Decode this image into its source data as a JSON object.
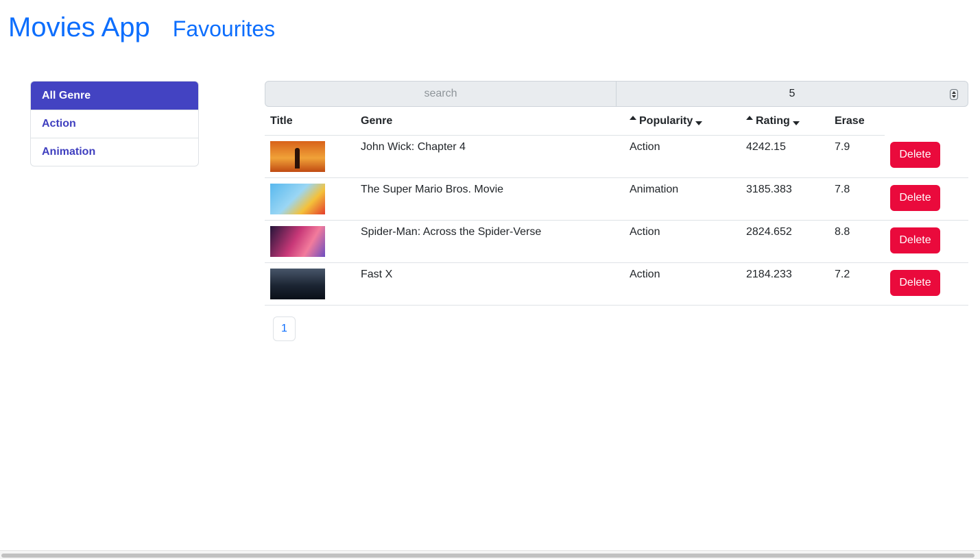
{
  "nav": {
    "brand": "Movies App",
    "favourites": "Favourites"
  },
  "genres": [
    {
      "label": "All Genre",
      "active": true
    },
    {
      "label": "Action",
      "active": false
    },
    {
      "label": "Animation",
      "active": false
    }
  ],
  "search": {
    "placeholder": "search",
    "value": ""
  },
  "count": {
    "value": "5"
  },
  "table": {
    "headers": {
      "title": "Title",
      "genre": "Genre",
      "popularity": "Popularity",
      "rating": "Rating",
      "erase": "Erase"
    },
    "rows": [
      {
        "title": "John Wick: Chapter 4",
        "genre": "Action",
        "popularity": "4242.15",
        "rating": "7.9",
        "action": "Delete"
      },
      {
        "title": "The Super Mario Bros. Movie",
        "genre": "Animation",
        "popularity": "3185.383",
        "rating": "7.8",
        "action": "Delete"
      },
      {
        "title": "Spider-Man: Across the Spider-Verse",
        "genre": "Action",
        "popularity": "2824.652",
        "rating": "8.8",
        "action": "Delete"
      },
      {
        "title": "Fast X",
        "genre": "Action",
        "popularity": "2184.233",
        "rating": "7.2",
        "action": "Delete"
      }
    ]
  },
  "pagination": {
    "pages": [
      "1"
    ]
  },
  "colors": {
    "brand": "#0d6efd",
    "active_genre": "#4343c2",
    "delete": "#ea0a3c"
  }
}
